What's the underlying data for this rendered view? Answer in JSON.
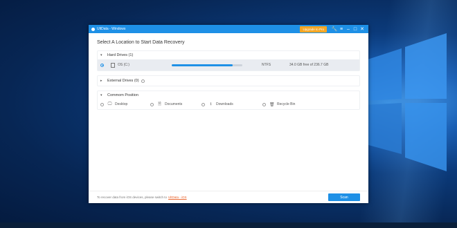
{
  "window": {
    "title": "UltData - Windows",
    "upgrade_label": "Upgrade to Pro"
  },
  "main": {
    "heading": "Select A Location to Start Data Recovery"
  },
  "hard_drives": {
    "label": "Hard Drives (1)",
    "drives": [
      {
        "name": "OS (C:)",
        "filesystem": "NTFS",
        "free_text": "34.0 GB free of 236.7 GB",
        "used_fraction": 0.86,
        "selected": true
      }
    ]
  },
  "external_drives": {
    "label": "External Drives (0)"
  },
  "common_position": {
    "label": "Commom Position",
    "items": [
      {
        "label": "Desktop",
        "icon": "desktop-icon"
      },
      {
        "label": "Documents",
        "icon": "document-icon"
      },
      {
        "label": "Downloads",
        "icon": "download-icon"
      },
      {
        "label": "Recycle Bin",
        "icon": "recycle-bin-icon"
      }
    ]
  },
  "footer": {
    "text": "To recover data from iOS devices, please switch to",
    "link": "UltData - iOS",
    "scan_label": "Scan"
  },
  "colors": {
    "accent": "#1e90e6",
    "upgrade": "#f5a623",
    "link": "#e8632b"
  }
}
